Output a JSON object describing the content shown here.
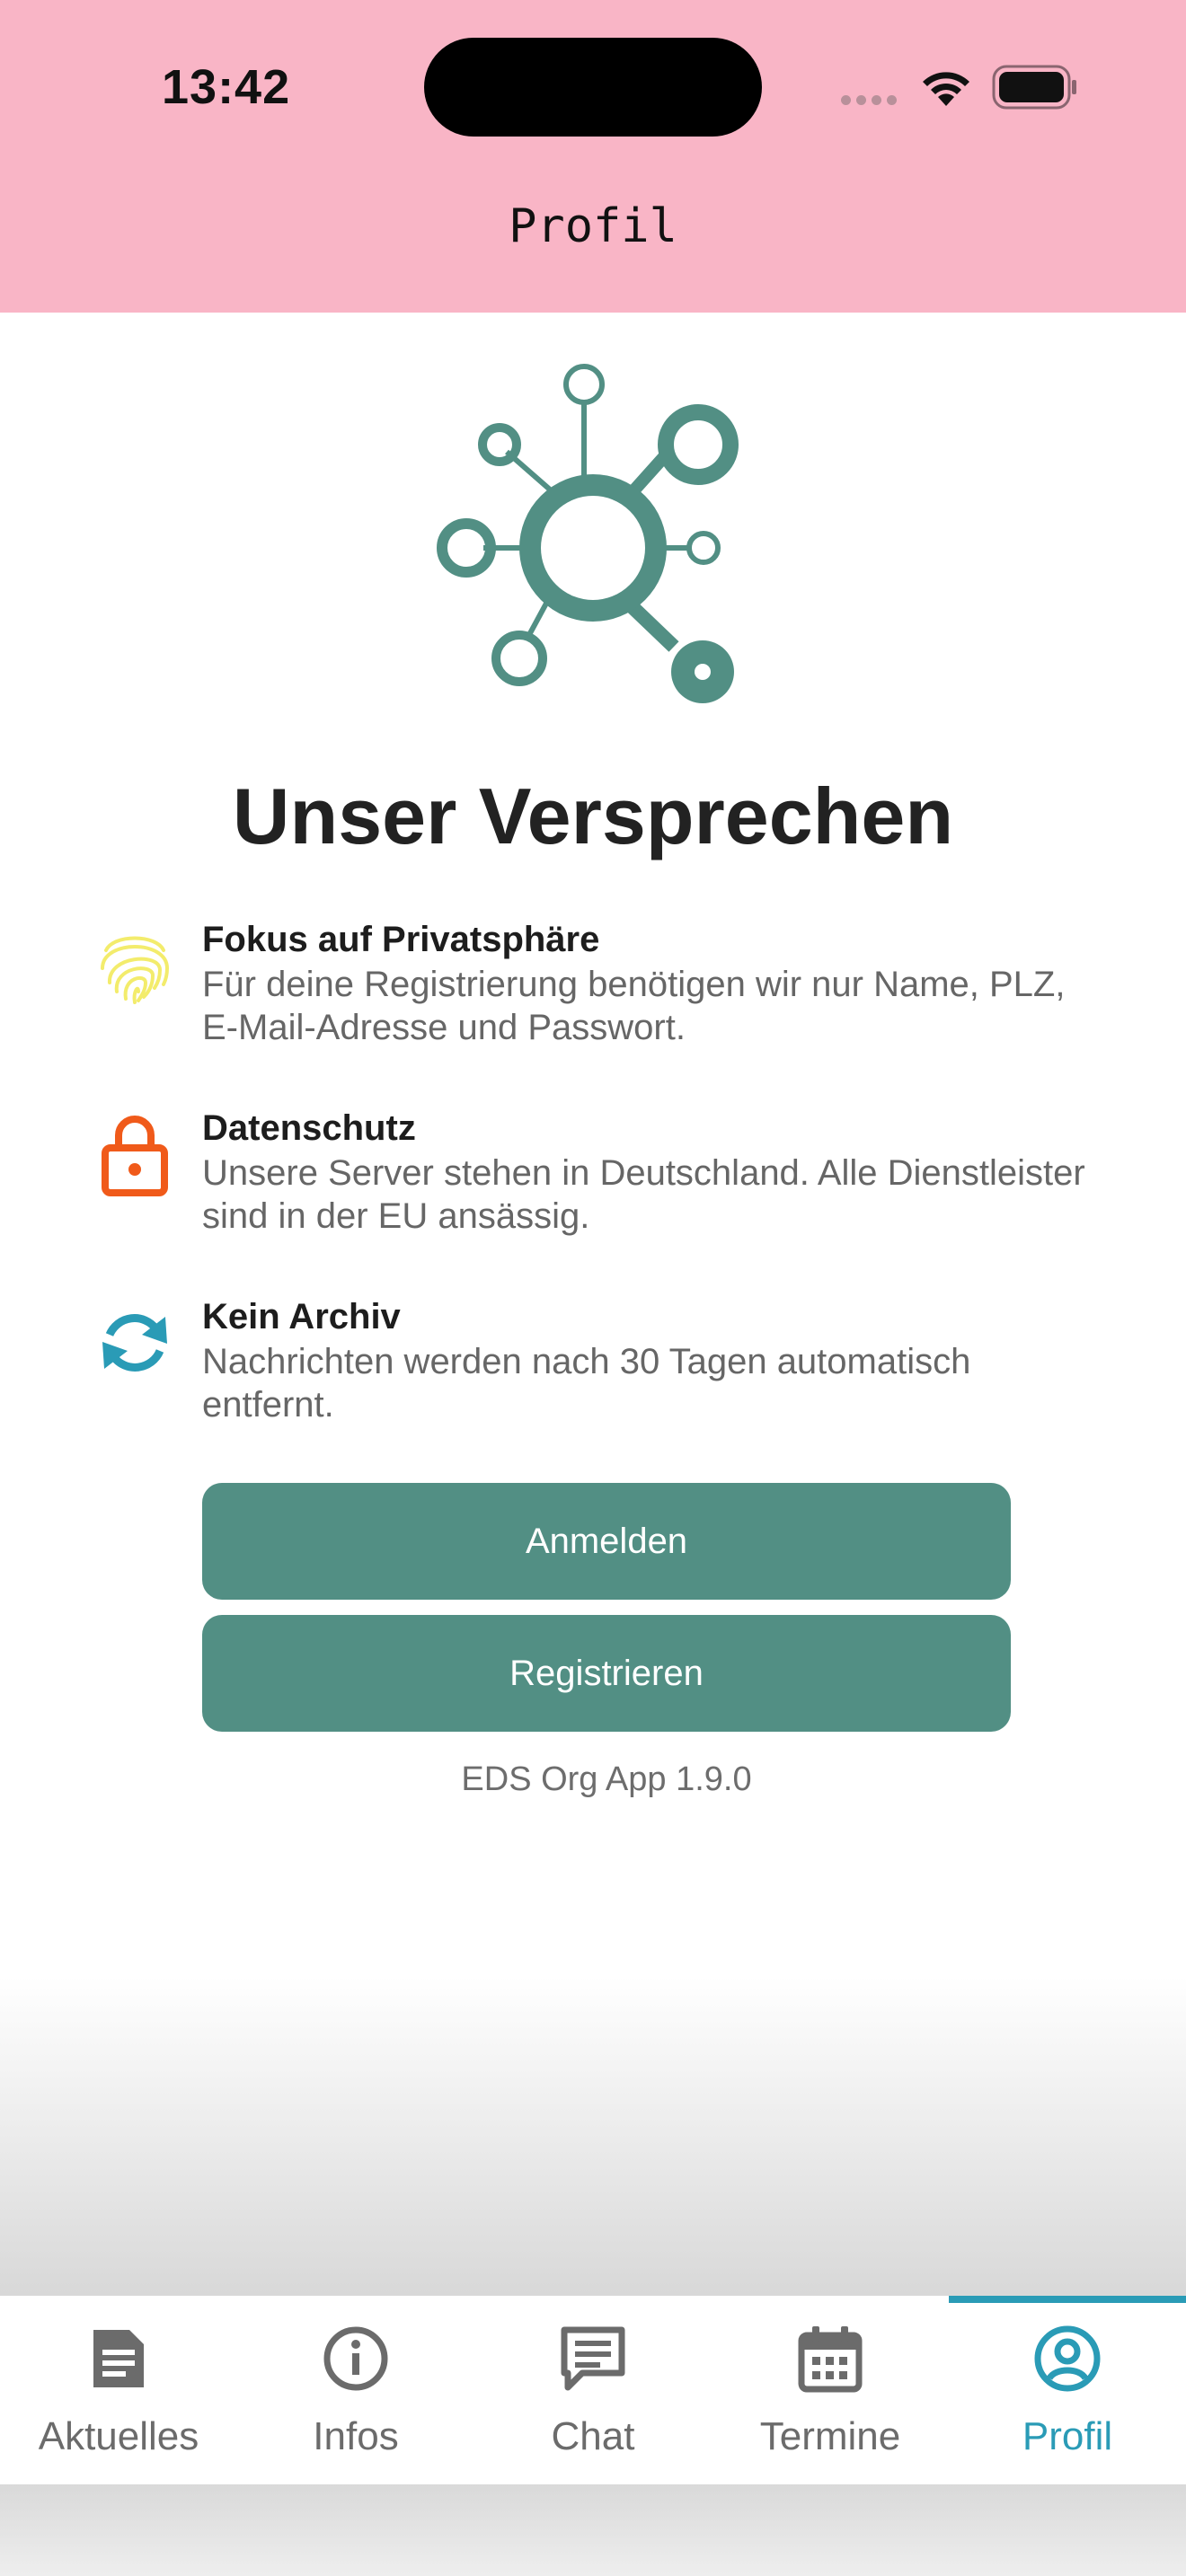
{
  "status_bar": {
    "time": "13:42"
  },
  "header": {
    "title": "Profil"
  },
  "hero": {
    "icon": "network-hub-icon",
    "heading": "Unser Versprechen"
  },
  "features": [
    {
      "icon": "fingerprint-icon",
      "title": "Fokus auf Privatsphäre",
      "description": "Für deine Registrierung benötigen wir nur Name, PLZ, E-Mail-Adresse und Passwort."
    },
    {
      "icon": "lock-icon",
      "title": "Datenschutz",
      "description": "Unsere Server stehen in Deutschland. Alle Dienstleister sind in der EU ansässig."
    },
    {
      "icon": "sync-icon",
      "title": "Kein Archiv",
      "description": "Nachrichten werden nach 30 Tagen automatisch entfernt."
    }
  ],
  "buttons": {
    "login_label": "Anmelden",
    "register_label": "Registrieren"
  },
  "version": "EDS Org App 1.9.0",
  "tabs": [
    {
      "label": "Aktuelles",
      "icon": "document-icon"
    },
    {
      "label": "Infos",
      "icon": "info-icon"
    },
    {
      "label": "Chat",
      "icon": "chat-icon"
    },
    {
      "label": "Termine",
      "icon": "calendar-icon"
    },
    {
      "label": "Profil",
      "icon": "profile-icon",
      "active": true
    }
  ],
  "colors": {
    "header_bg": "#f9b5c6",
    "accent_green": "#528f84",
    "accent_blue": "#2a9bb6",
    "fingerprint": "#f3ec6c",
    "lock": "#f05a1a"
  }
}
